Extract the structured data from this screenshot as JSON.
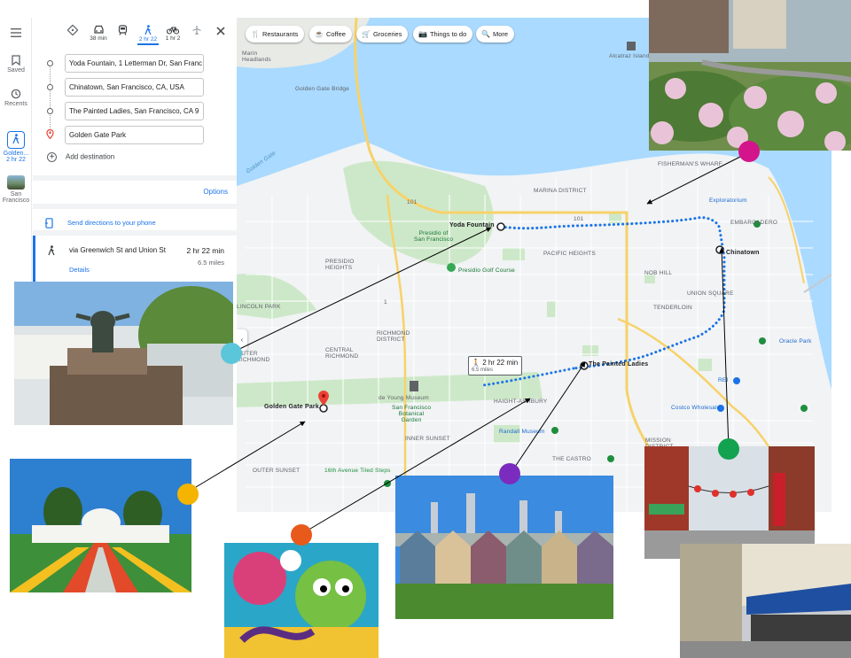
{
  "rail": {
    "menu_icon": "menu-icon",
    "saved_label": "Saved",
    "recents_label": "Recents",
    "active_trip_label_1": "Golden...",
    "active_trip_label_2": "2 hr 22",
    "sf_label_1": "San",
    "sf_label_2": "Francisco"
  },
  "travel_modes": [
    {
      "name": "best",
      "label": ""
    },
    {
      "name": "drive",
      "label": "38 min"
    },
    {
      "name": "transit",
      "label": ""
    },
    {
      "name": "walk",
      "label": "2 hr 22"
    },
    {
      "name": "bike",
      "label": "1 hr 2"
    },
    {
      "name": "flight",
      "label": ""
    }
  ],
  "stops": [
    {
      "value": "Yoda Fountain, 1 Letterman Dr, San Franc"
    },
    {
      "value": "Chinatown, San Francisco, CA, USA"
    },
    {
      "value": "The Painted Ladies, San Francisco, CA 9"
    },
    {
      "value": "Golden Gate Park"
    }
  ],
  "add_destination_label": "Add destination",
  "options_label": "Options",
  "send_directions_label": "Send directions to your phone",
  "route": {
    "via": "via Greenwich St and Union St",
    "time": "2 hr 22 min",
    "distance": "6.5 miles",
    "details_label": "Details"
  },
  "map": {
    "chips": [
      {
        "label": "Restaurants",
        "icon": "restaurant-icon"
      },
      {
        "label": "Coffee",
        "icon": "coffee-icon"
      },
      {
        "label": "Groceries",
        "icon": "cart-icon"
      },
      {
        "label": "Things to do",
        "icon": "camera-icon"
      },
      {
        "label": "More",
        "icon": "search-icon"
      }
    ],
    "labels": {
      "marin_headlands": "Marin\nHeadlands",
      "alcatraz": "Alcatraz Island",
      "golden_gate_bridge": "Golden Gate Bridge",
      "golden_gate_water": "Golden Gate",
      "fishermans_wharf": "FISHERMAN'S WHARF",
      "marina": "MARINA DISTRICT",
      "exploratorium": "Exploratorium",
      "embarcadero": "EMBARCADERO",
      "presidio": "Presidio of\nSan Francisco",
      "presidio_heights": "PRESIDIO\nHEIGHTS",
      "pacific_heights": "PACIFIC HEIGHTS",
      "presidio_golf": "Presidio Golf Course",
      "nob_hill": "NOB HILL",
      "union_square": "UNION SQUARE",
      "tenderloin": "TENDERLOIN",
      "chinatown": "Chinatown",
      "yoda_fountain": "Yoda Fountain",
      "outer_richmond": "OUTER\nRICHMOND",
      "central_richmond": "CENTRAL\nRICHMOND",
      "richmond_district": "RICHMOND\nDISTRICT",
      "lincoln_park": "LINCOLN PARK",
      "de_young": "de Young Museum",
      "sf_botanical": "San Francisco\nBotanical\nGarden",
      "golden_gate_park": "Golden Gate Park",
      "haight": "HAIGHT-ASHBURY",
      "painted_ladies": "The Painted Ladies",
      "oracle_park": "Oracle Park",
      "rei": "REI",
      "costco": "Costco Wholesale",
      "randall": "Randall Museum",
      "inner_sunset": "INNER SUNSET",
      "outer_sunset": "OUTER SUNSET",
      "the_castro": "THE CASTRO",
      "mission": "MISSION\nDISTRICT",
      "tiled_steps": "16th Avenue Tiled Steps",
      "route_101a": "101",
      "route_101b": "101",
      "route_1": "1"
    },
    "route_badge_time": "2 hr 22 min",
    "route_badge_dist": "6.5 miles"
  },
  "colors": {
    "accent": "#1a73e8",
    "route": "#1a73e8",
    "water": "#aadaff",
    "land": "#f1f3f4",
    "park": "#c8e6c9",
    "dot_cyan": "#5bc6da",
    "dot_yellow": "#f4b400",
    "dot_orange": "#e8591c",
    "dot_purple": "#7b2cbf",
    "dot_green": "#13a24f",
    "dot_magenta": "#d4148b"
  }
}
